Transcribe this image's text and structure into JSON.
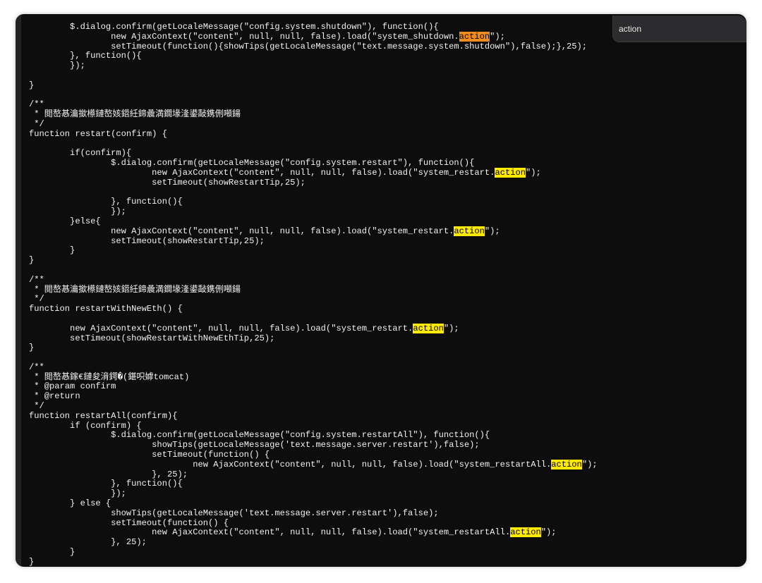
{
  "find_bar": {
    "query": "action"
  },
  "highlight_term": "action",
  "code_lines": [
    "        $.dialog.confirm(getLocaleMessage(\"config.system.shutdown\"), function(){",
    "                new AjaxContext(\"content\", null, null, false).load(\"system_shutdown.[[[action]]]\");",
    "                setTimeout(function(){showTips(getLocaleMessage(\"text.message.system.shutdown\"),false);},25);",
    "        }, function(){",
    "        });",
    "",
    "}",
    "",
    "/**",
    " * 閲嶅惎瀹撳櫒鏈嶅姟鍣紝鍗曟満鐗堟湰鍙敮鎸侀噸鍚",
    " */",
    "function restart(confirm) {",
    "",
    "        if(confirm){",
    "                $.dialog.confirm(getLocaleMessage(\"config.system.restart\"), function(){",
    "                        new AjaxContext(\"content\", null, null, false).load(\"system_restart.{{{action}}}\");",
    "                        setTimeout(showRestartTip,25);",
    "",
    "                }, function(){",
    "                });",
    "        }else{",
    "                new AjaxContext(\"content\", null, null, false).load(\"system_restart.{{{action}}}\");",
    "                setTimeout(showRestartTip,25);",
    "        }",
    "}",
    "",
    "/**",
    " * 閲嶅惎瀹撳櫒鏈嶅姟鍣紝鍗曟満鐗堟湰鍙敮鎸侀噸鍚",
    " */",
    "function restartWithNewEth() {",
    "",
    "        new AjaxContext(\"content\", null, null, false).load(\"system_restart.{{{action}}}\");",
    "        setTimeout(showRestartWithNewEthTip,25);",
    "}",
    "",
    "/**",
    " * 閲嶅惎鎵€鏈夋湇鍔�(鍖呮嫭tomcat)",
    " * @param confirm",
    " * @return",
    " */",
    "function restartAll(confirm){",
    "        if (confirm) {",
    "                $.dialog.confirm(getLocaleMessage(\"config.system.restartAll\"), function(){",
    "                        showTips(getLocaleMessage('text.message.server.restart'),false);",
    "                        setTimeout(function() {",
    "                                new AjaxContext(\"content\", null, null, false).load(\"system_restartAll.{{{action}}}\");",
    "                        }, 25);",
    "                }, function(){",
    "                });",
    "        } else {",
    "                showTips(getLocaleMessage('text.message.server.restart'),false);",
    "                setTimeout(function() {",
    "                        new AjaxContext(\"content\", null, null, false).load(\"system_restartAll.{{{action}}}\");",
    "                }, 25);",
    "        }",
    "}"
  ]
}
